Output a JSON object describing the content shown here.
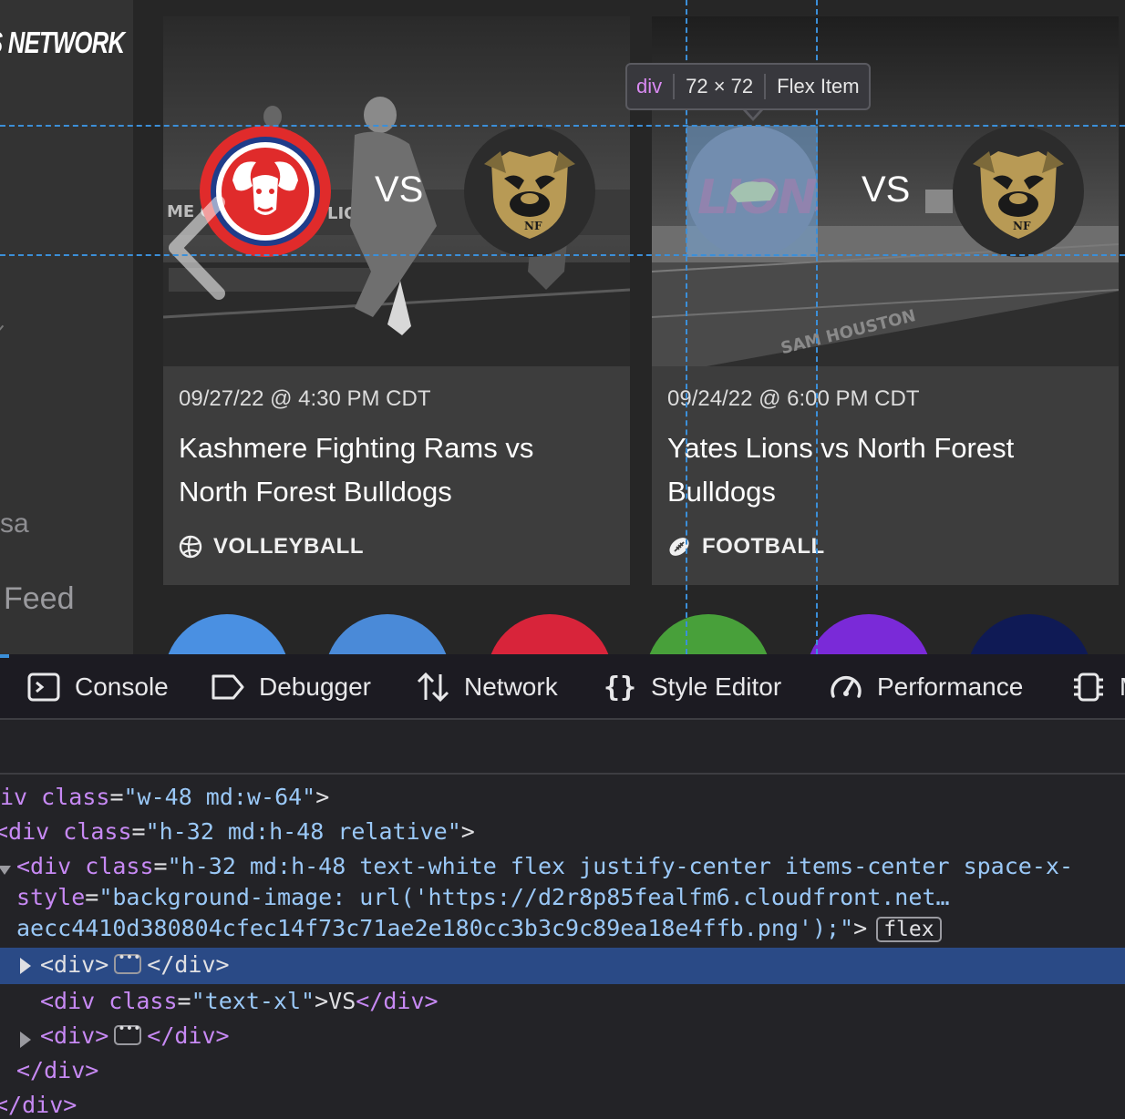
{
  "sidebar": {
    "brand": "S NETWORK",
    "fragment_1": "sa",
    "fragment_2": "Feed"
  },
  "cards": [
    {
      "date": "09/27/22 @ 4:30 PM CDT",
      "title": "Kashmere Fighting Rams vs North Forest Bulldogs",
      "vs": "VS",
      "sport": "VOLLEYBALL",
      "sport_icon": "volleyball-icon",
      "home_logo": "rams-logo",
      "away_logo": "bulldogs-logo"
    },
    {
      "date": "09/24/22 @ 6:00 PM CDT",
      "title": "Yates Lions vs North Forest Bulldogs",
      "vs": "VS",
      "sport": "FOOTBALL",
      "sport_icon": "football-icon",
      "home_logo": "lions-logo",
      "away_logo": "bulldogs-logo"
    }
  ],
  "inspector_tooltip": {
    "tag": "div",
    "size": "72 × 72",
    "kind": "Flex Item"
  },
  "devtools": {
    "tabs": [
      {
        "label": "Console",
        "icon": "console-icon"
      },
      {
        "label": "Debugger",
        "icon": "debugger-icon"
      },
      {
        "label": "Network",
        "icon": "network-icon"
      },
      {
        "label": "Style Editor",
        "icon": "style-editor-icon"
      },
      {
        "label": "Performance",
        "icon": "performance-icon"
      },
      {
        "label": "M",
        "icon": "memory-icon"
      }
    ],
    "markup": {
      "line1_prefix": "iv",
      "line1_attr": "class",
      "line1_val": "\"w-48 md:w-64\"",
      "line2_tag": "<div",
      "line2_attr": "class",
      "line2_val": "\"h-32 md:h-48 relative\"",
      "line3_tag": "<div",
      "line3_attr": "class",
      "line3_val": "\"h-32 md:h-48 text-white flex justify-center items-center space-x-",
      "line4_attr": "style",
      "line4_val": "\"background-image: url('https://d2r8p85fealfm6.cloudfront.net…",
      "line5_val": "aecc4410d380804cfec14f73c71ae2e180cc3b3c9c89ea18e4ffb.png');\"",
      "line5_close": ">",
      "line5_badge": "flex",
      "line6_open": "<div>",
      "line6_close": "</div>",
      "line7_tag": "<div",
      "line7_attr": "class",
      "line7_val": "\"text-xl\"",
      "line7_text": "VS",
      "line7_close": "</div>",
      "line8_open": "<div>",
      "line8_close": "</div>",
      "line9_close": "</div>",
      "line10_close": "</div>"
    }
  }
}
